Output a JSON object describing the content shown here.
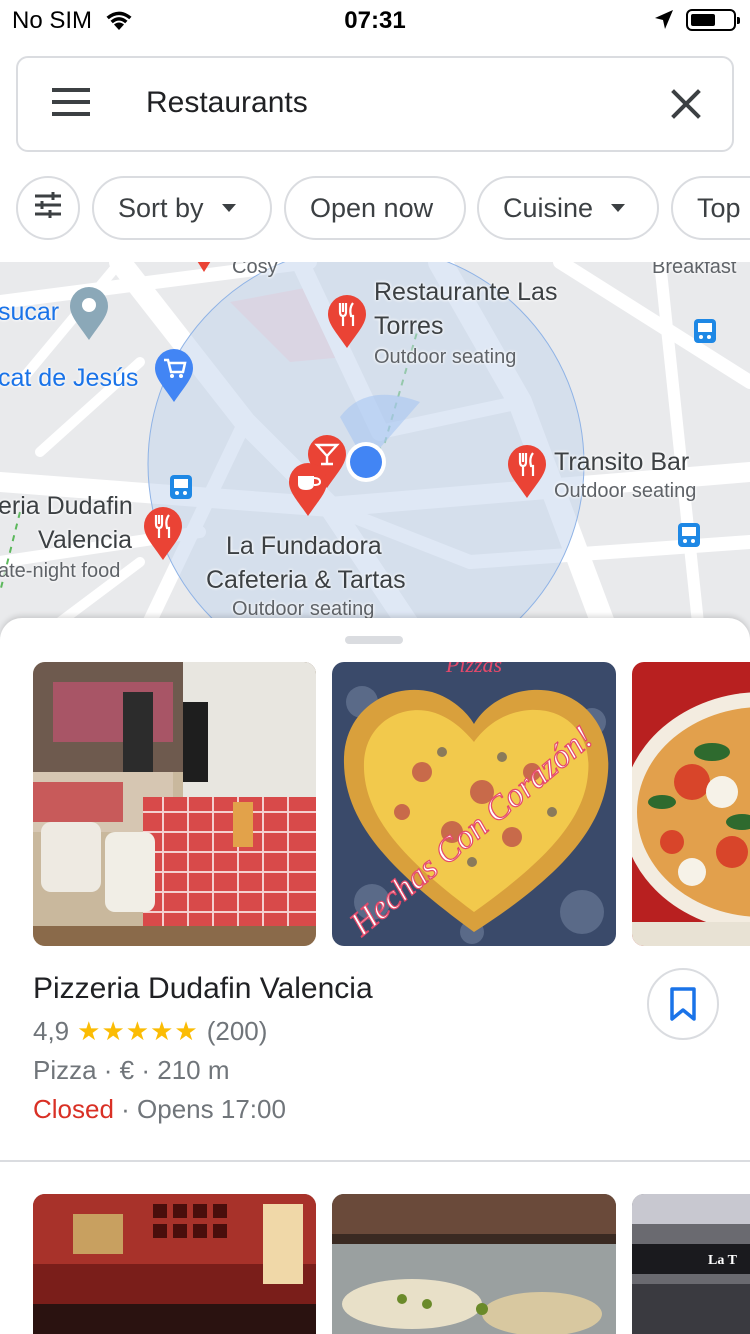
{
  "status_bar": {
    "carrier": "No SIM",
    "time": "07:31"
  },
  "search": {
    "query": "Restaurants",
    "menu_icon": "hamburger-menu-icon",
    "clear_icon": "close-icon"
  },
  "chips": {
    "filters_icon": "tune-icon",
    "sort": "Sort by",
    "open_now": "Open now",
    "cuisine": "Cuisine",
    "top": "Top"
  },
  "map": {
    "labels": {
      "cosy": "Cosy",
      "breakfast": "Breakfast",
      "sucar": "sucar",
      "mercat": "cat de Jesús",
      "las_torres_1": "Restaurante Las",
      "las_torres_2": "Torres",
      "las_torres_sub": "Outdoor seating",
      "transito": "Transito Bar",
      "transito_sub": "Outdoor seating",
      "dudafin_1": "eria Dudafin",
      "dudafin_2": "Valencia",
      "dudafin_sub": "ate-night food",
      "fundadora_1": "La Fundadora",
      "fundadora_2": "Cafeteria & Tartas",
      "fundadora_sub": "Outdoor seating"
    },
    "colors": {
      "pin_red": "#ea4335",
      "pin_blue": "#4285f4",
      "my_location": "#4285f4",
      "radius_fill": "#c5d6ec"
    }
  },
  "listing": {
    "name": "Pizzeria Dudafin Valencia",
    "rating": "4,9",
    "stars": "★★★★★",
    "review_count": "(200)",
    "category": "Pizza · € · 210 m",
    "status": "Closed",
    "hours": " · Opens 17:00",
    "save_icon": "bookmark-icon",
    "photo_text": "Hechas Con Corazón!"
  }
}
